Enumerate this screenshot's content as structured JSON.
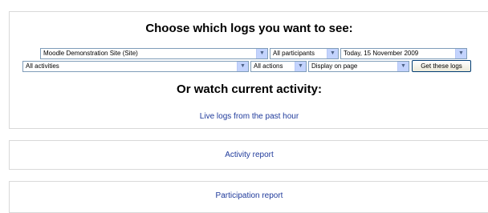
{
  "logs_panel": {
    "title": "Choose which logs you want to see:",
    "course_select": "Moodle Demonstration Site (Site)",
    "participants_select": "All participants",
    "date_select": "Today, 15 November 2009",
    "activities_select": "All activities",
    "actions_select": "All actions",
    "display_select": "Display on page",
    "submit_button": "Get these logs",
    "watch_title": "Or watch current activity:",
    "live_logs_link": "Live logs from the past hour"
  },
  "reports": {
    "activity_link": "Activity report",
    "participation_link": "Participation report"
  },
  "icons": {
    "dropdown": "chevron-down-icon"
  },
  "colors": {
    "link": "#1f3a9b",
    "border": "#d9d9d9"
  }
}
